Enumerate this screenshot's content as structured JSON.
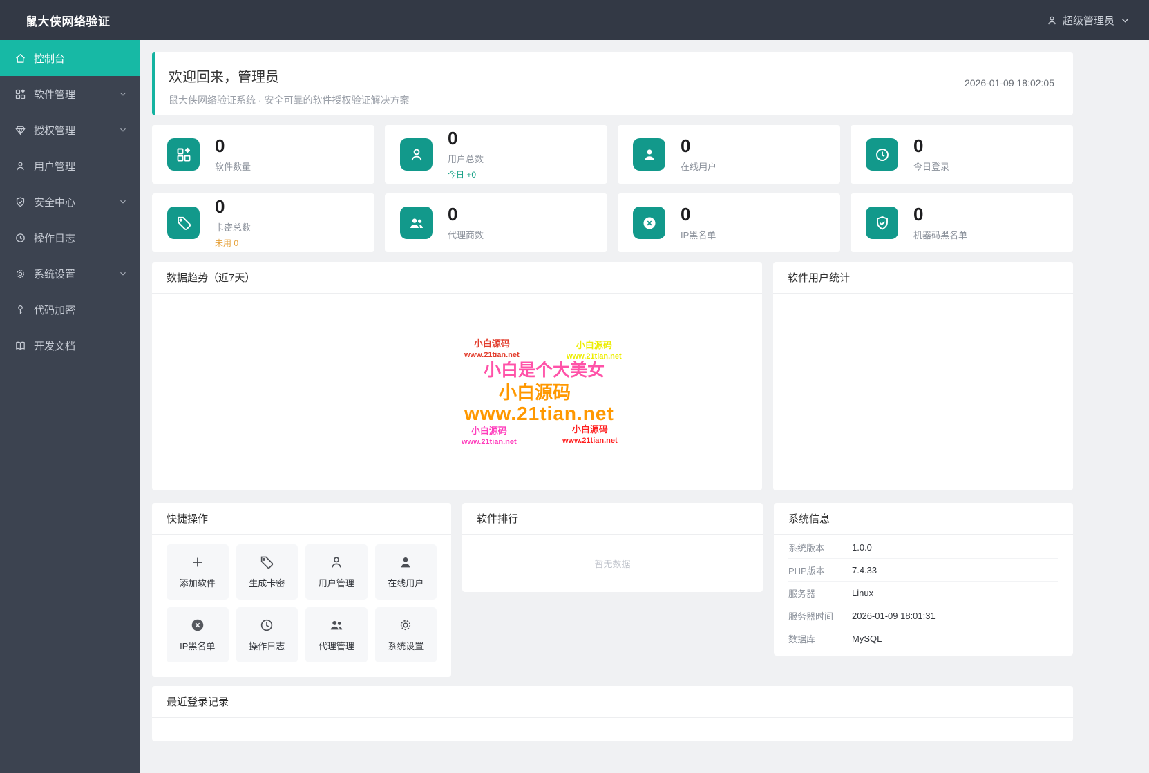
{
  "app": {
    "title": "鼠大侠网络验证"
  },
  "colors": {
    "primary_teal": "#17b9a5",
    "icon_teal": "#12998b",
    "success_green": "#16a085",
    "warning_orange": "#e6a23c",
    "header_dark": "#333945",
    "sidebar_dark": "#3c4350"
  },
  "header": {
    "user_label": "超级管理员",
    "user_icon": "user-icon",
    "chevron_icon": "chevron-down-icon"
  },
  "sidebar": {
    "items": [
      {
        "label": "控制台",
        "icon": "home-icon",
        "active": true,
        "expandable": false
      },
      {
        "label": "软件管理",
        "icon": "apps-icon",
        "active": false,
        "expandable": true
      },
      {
        "label": "授权管理",
        "icon": "gem-icon",
        "active": false,
        "expandable": true
      },
      {
        "label": "用户管理",
        "icon": "user-icon",
        "active": false,
        "expandable": false
      },
      {
        "label": "安全中心",
        "icon": "shield-check-icon",
        "active": false,
        "expandable": true
      },
      {
        "label": "操作日志",
        "icon": "clock-icon",
        "active": false,
        "expandable": false
      },
      {
        "label": "系统设置",
        "icon": "gear-icon",
        "active": false,
        "expandable": true
      },
      {
        "label": "代码加密",
        "icon": "key-icon",
        "active": false,
        "expandable": false
      },
      {
        "label": "开发文档",
        "icon": "book-icon",
        "active": false,
        "expandable": false
      }
    ]
  },
  "welcome": {
    "title": "欢迎回来，管理员",
    "subtitle": "鼠大侠网络验证系统 · 安全可靠的软件授权验证解决方案",
    "timestamp": "2026-01-09 18:02:05"
  },
  "stats": [
    {
      "value": "0",
      "label": "软件数量",
      "icon": "apps-icon"
    },
    {
      "value": "0",
      "label": "用户总数",
      "sub": "今日 +0",
      "icon": "user-outline-icon"
    },
    {
      "value": "0",
      "label": "在线用户",
      "icon": "user-solid-icon"
    },
    {
      "value": "0",
      "label": "今日登录",
      "icon": "clock-icon"
    },
    {
      "value": "0",
      "label": "卡密总数",
      "sub": "未用 0",
      "icon": "tag-icon"
    },
    {
      "value": "0",
      "label": "代理商数",
      "icon": "users-icon"
    },
    {
      "value": "0",
      "label": "IP黑名单",
      "icon": "circle-x-icon"
    },
    {
      "value": "0",
      "label": "机器码黑名单",
      "icon": "shield-check-icon"
    }
  ],
  "panels": {
    "trend": {
      "title": "数据趋势（近7天）"
    },
    "user_stats": {
      "title": "软件用户统计"
    }
  },
  "chart_data": {
    "type": "line",
    "title": "数据趋势（近7天）",
    "series": [],
    "note": "chart area empty, only site watermarks visible"
  },
  "watermarks": {
    "tl": {
      "line1": "小白源码",
      "line2": "www.21tian.net",
      "color": "#e23d2d"
    },
    "tr": {
      "line1": "小白源码",
      "line2": "www.21tian.net",
      "color": "#eded00"
    },
    "big1": {
      "text": "小白是个大美女",
      "color": "#ff52a8"
    },
    "big2": {
      "text": "小白源码",
      "color": "#ff9800"
    },
    "big3": {
      "text": "www.21tian.net",
      "color": "#ff9800"
    },
    "bl": {
      "line1": "小白源码",
      "line2": "www.21tian.net",
      "color": "#ff3dbc"
    },
    "br": {
      "line1": "小白源码",
      "line2": "www.21tian.net",
      "color": "#ff1f1f"
    }
  },
  "quick": {
    "title": "快捷操作",
    "items": [
      {
        "label": "添加软件",
        "icon": "plus-icon"
      },
      {
        "label": "生成卡密",
        "icon": "tag-icon"
      },
      {
        "label": "用户管理",
        "icon": "user-outline-icon"
      },
      {
        "label": "在线用户",
        "icon": "user-solid-icon"
      },
      {
        "label": "IP黑名单",
        "icon": "circle-x-icon"
      },
      {
        "label": "操作日志",
        "icon": "clock-icon"
      },
      {
        "label": "代理管理",
        "icon": "users-icon"
      },
      {
        "label": "系统设置",
        "icon": "gear-icon"
      }
    ]
  },
  "ranking": {
    "title": "软件排行",
    "empty": "暂无数据"
  },
  "sysinfo": {
    "title": "系统信息",
    "rows": [
      {
        "label": "系统版本",
        "value": "1.0.0"
      },
      {
        "label": "PHP版本",
        "value": "7.4.33"
      },
      {
        "label": "服务器",
        "value": "Linux"
      },
      {
        "label": "服务器时间",
        "value": "2026-01-09 18:01:31"
      },
      {
        "label": "数据库",
        "value": "MySQL"
      }
    ]
  },
  "recent": {
    "title": "最近登录记录"
  }
}
